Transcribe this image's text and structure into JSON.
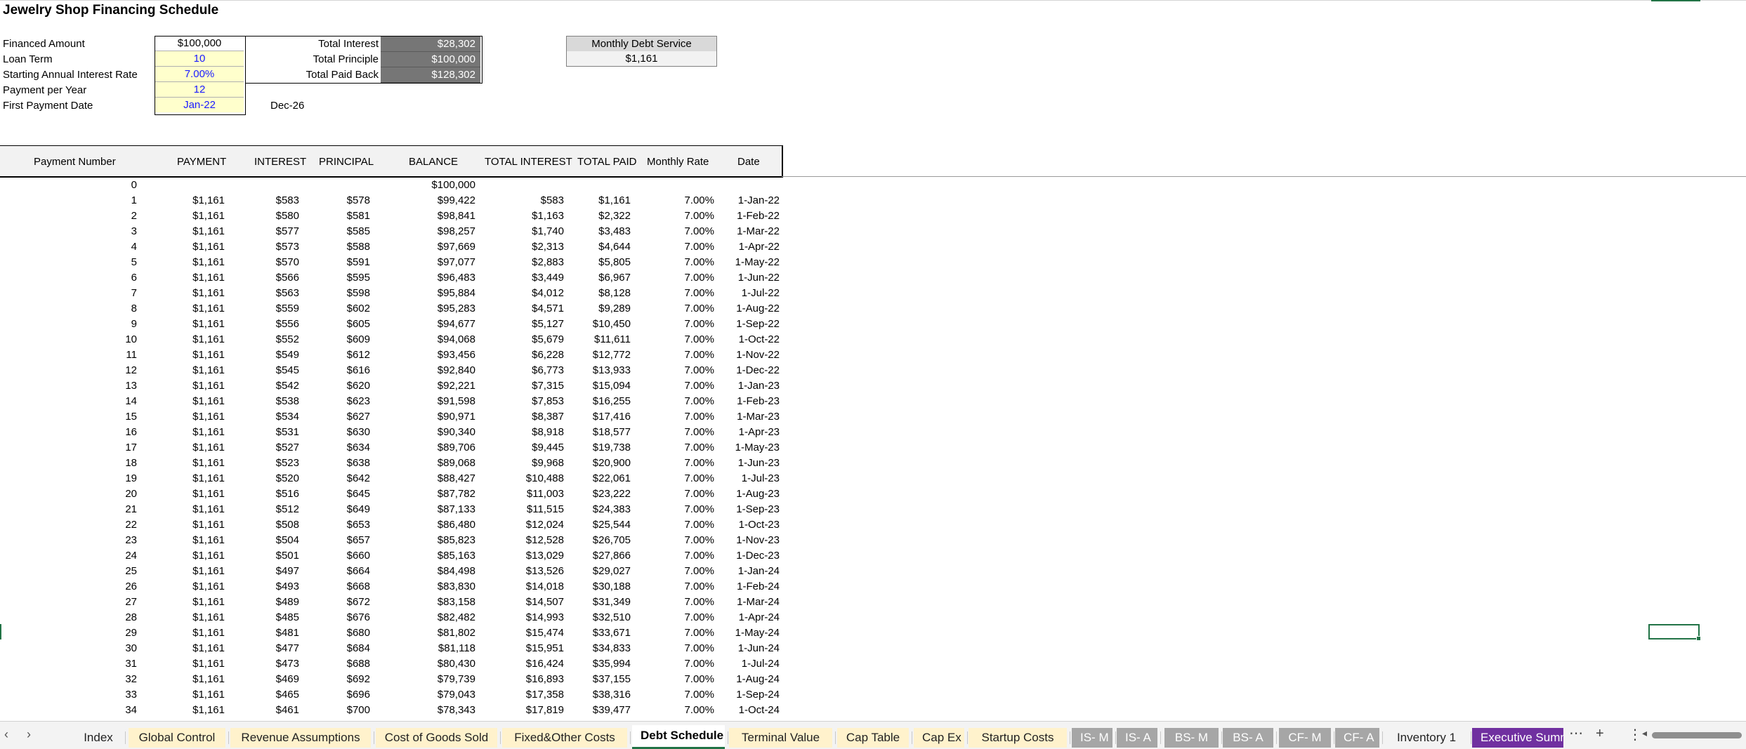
{
  "sheet_title": "Jewelry Shop Financing Schedule",
  "params": [
    {
      "label": "Financed Amount",
      "value": "$100,000",
      "style": "plain"
    },
    {
      "label": "Loan Term",
      "value": "10",
      "style": "yellow"
    },
    {
      "label": "Starting Annual Interest Rate",
      "value": "7.00%",
      "style": "yellow"
    },
    {
      "label": "Payment per Year",
      "value": "12",
      "style": "yellow"
    },
    {
      "label": "First Payment Date",
      "value": "Jan-22",
      "style": "yellow"
    }
  ],
  "end_date": "Dec-26",
  "totals": [
    {
      "label": "Total Interest",
      "value": "$28,302"
    },
    {
      "label": "Total Principle",
      "value": "$100,000"
    },
    {
      "label": "Total Paid Back",
      "value": "$128,302"
    }
  ],
  "monthly_debt_service": {
    "label": "Monthly Debt Service",
    "value": "$1,161"
  },
  "columns": [
    "Payment Number",
    "PAYMENT",
    "INTEREST",
    "PRINCIPAL",
    "BALANCE",
    "TOTAL INTEREST",
    "TOTAL PAID",
    "Monthly Rate",
    "Date"
  ],
  "rows": [
    [
      "0",
      "",
      "",
      "",
      "$100,000",
      "",
      "",
      "",
      ""
    ],
    [
      "1",
      "$1,161",
      "$583",
      "$578",
      "$99,422",
      "$583",
      "$1,161",
      "7.00%",
      "1-Jan-22"
    ],
    [
      "2",
      "$1,161",
      "$580",
      "$581",
      "$98,841",
      "$1,163",
      "$2,322",
      "7.00%",
      "1-Feb-22"
    ],
    [
      "3",
      "$1,161",
      "$577",
      "$585",
      "$98,257",
      "$1,740",
      "$3,483",
      "7.00%",
      "1-Mar-22"
    ],
    [
      "4",
      "$1,161",
      "$573",
      "$588",
      "$97,669",
      "$2,313",
      "$4,644",
      "7.00%",
      "1-Apr-22"
    ],
    [
      "5",
      "$1,161",
      "$570",
      "$591",
      "$97,077",
      "$2,883",
      "$5,805",
      "7.00%",
      "1-May-22"
    ],
    [
      "6",
      "$1,161",
      "$566",
      "$595",
      "$96,483",
      "$3,449",
      "$6,967",
      "7.00%",
      "1-Jun-22"
    ],
    [
      "7",
      "$1,161",
      "$563",
      "$598",
      "$95,884",
      "$4,012",
      "$8,128",
      "7.00%",
      "1-Jul-22"
    ],
    [
      "8",
      "$1,161",
      "$559",
      "$602",
      "$95,283",
      "$4,571",
      "$9,289",
      "7.00%",
      "1-Aug-22"
    ],
    [
      "9",
      "$1,161",
      "$556",
      "$605",
      "$94,677",
      "$5,127",
      "$10,450",
      "7.00%",
      "1-Sep-22"
    ],
    [
      "10",
      "$1,161",
      "$552",
      "$609",
      "$94,068",
      "$5,679",
      "$11,611",
      "7.00%",
      "1-Oct-22"
    ],
    [
      "11",
      "$1,161",
      "$549",
      "$612",
      "$93,456",
      "$6,228",
      "$12,772",
      "7.00%",
      "1-Nov-22"
    ],
    [
      "12",
      "$1,161",
      "$545",
      "$616",
      "$92,840",
      "$6,773",
      "$13,933",
      "7.00%",
      "1-Dec-22"
    ],
    [
      "13",
      "$1,161",
      "$542",
      "$620",
      "$92,221",
      "$7,315",
      "$15,094",
      "7.00%",
      "1-Jan-23"
    ],
    [
      "14",
      "$1,161",
      "$538",
      "$623",
      "$91,598",
      "$7,853",
      "$16,255",
      "7.00%",
      "1-Feb-23"
    ],
    [
      "15",
      "$1,161",
      "$534",
      "$627",
      "$90,971",
      "$8,387",
      "$17,416",
      "7.00%",
      "1-Mar-23"
    ],
    [
      "16",
      "$1,161",
      "$531",
      "$630",
      "$90,340",
      "$8,918",
      "$18,577",
      "7.00%",
      "1-Apr-23"
    ],
    [
      "17",
      "$1,161",
      "$527",
      "$634",
      "$89,706",
      "$9,445",
      "$19,738",
      "7.00%",
      "1-May-23"
    ],
    [
      "18",
      "$1,161",
      "$523",
      "$638",
      "$89,068",
      "$9,968",
      "$20,900",
      "7.00%",
      "1-Jun-23"
    ],
    [
      "19",
      "$1,161",
      "$520",
      "$642",
      "$88,427",
      "$10,488",
      "$22,061",
      "7.00%",
      "1-Jul-23"
    ],
    [
      "20",
      "$1,161",
      "$516",
      "$645",
      "$87,782",
      "$11,003",
      "$23,222",
      "7.00%",
      "1-Aug-23"
    ],
    [
      "21",
      "$1,161",
      "$512",
      "$649",
      "$87,133",
      "$11,515",
      "$24,383",
      "7.00%",
      "1-Sep-23"
    ],
    [
      "22",
      "$1,161",
      "$508",
      "$653",
      "$86,480",
      "$12,024",
      "$25,544",
      "7.00%",
      "1-Oct-23"
    ],
    [
      "23",
      "$1,161",
      "$504",
      "$657",
      "$85,823",
      "$12,528",
      "$26,705",
      "7.00%",
      "1-Nov-23"
    ],
    [
      "24",
      "$1,161",
      "$501",
      "$660",
      "$85,163",
      "$13,029",
      "$27,866",
      "7.00%",
      "1-Dec-23"
    ],
    [
      "25",
      "$1,161",
      "$497",
      "$664",
      "$84,498",
      "$13,526",
      "$29,027",
      "7.00%",
      "1-Jan-24"
    ],
    [
      "26",
      "$1,161",
      "$493",
      "$668",
      "$83,830",
      "$14,018",
      "$30,188",
      "7.00%",
      "1-Feb-24"
    ],
    [
      "27",
      "$1,161",
      "$489",
      "$672",
      "$83,158",
      "$14,507",
      "$31,349",
      "7.00%",
      "1-Mar-24"
    ],
    [
      "28",
      "$1,161",
      "$485",
      "$676",
      "$82,482",
      "$14,993",
      "$32,510",
      "7.00%",
      "1-Apr-24"
    ],
    [
      "29",
      "$1,161",
      "$481",
      "$680",
      "$81,802",
      "$15,474",
      "$33,671",
      "7.00%",
      "1-May-24"
    ],
    [
      "30",
      "$1,161",
      "$477",
      "$684",
      "$81,118",
      "$15,951",
      "$34,833",
      "7.00%",
      "1-Jun-24"
    ],
    [
      "31",
      "$1,161",
      "$473",
      "$688",
      "$80,430",
      "$16,424",
      "$35,994",
      "7.00%",
      "1-Jul-24"
    ],
    [
      "32",
      "$1,161",
      "$469",
      "$692",
      "$79,739",
      "$16,893",
      "$37,155",
      "7.00%",
      "1-Aug-24"
    ],
    [
      "33",
      "$1,161",
      "$465",
      "$696",
      "$79,043",
      "$17,358",
      "$38,316",
      "7.00%",
      "1-Sep-24"
    ],
    [
      "34",
      "$1,161",
      "$461",
      "$700",
      "$78,343",
      "$17,819",
      "$39,477",
      "7.00%",
      "1-Oct-24"
    ]
  ],
  "tabs": [
    {
      "label": "Index",
      "style": "plain"
    },
    {
      "label": "Global Control",
      "style": "yellow"
    },
    {
      "label": "Revenue Assumptions",
      "style": "yellow"
    },
    {
      "label": "Cost of Goods Sold",
      "style": "yellow"
    },
    {
      "label": "Fixed&Other Costs",
      "style": "yellow"
    },
    {
      "label": "Debt Schedule",
      "style": "active"
    },
    {
      "label": "Terminal Value",
      "style": "yellow"
    },
    {
      "label": "Cap Table",
      "style": "yellow"
    },
    {
      "label": "Cap Ex",
      "style": "yellow"
    },
    {
      "label": "Startup Costs",
      "style": "yellow"
    },
    {
      "label": "IS- M",
      "style": "gray"
    },
    {
      "label": "IS- A",
      "style": "gray"
    },
    {
      "label": "BS- M",
      "style": "gray"
    },
    {
      "label": "BS- A",
      "style": "gray"
    },
    {
      "label": "CF- M",
      "style": "gray"
    },
    {
      "label": "CF- A",
      "style": "gray"
    },
    {
      "label": "Inventory 1",
      "style": "plain"
    },
    {
      "label": "Executive Summ",
      "style": "purple"
    }
  ],
  "colors": {
    "accent": "#217346",
    "input_fill": "#ffffcc",
    "input_text": "#1a1aff",
    "total_fill": "#767676",
    "tab_yellow": "#fff2cc",
    "tab_gray": "#a6a6a6",
    "tab_purple": "#7030a0"
  },
  "icons": {
    "prev": "chevron-left-icon",
    "next": "chevron-right-icon",
    "more": "ellipsis-icon",
    "add": "plus-icon",
    "options": "vertical-dots-icon"
  }
}
